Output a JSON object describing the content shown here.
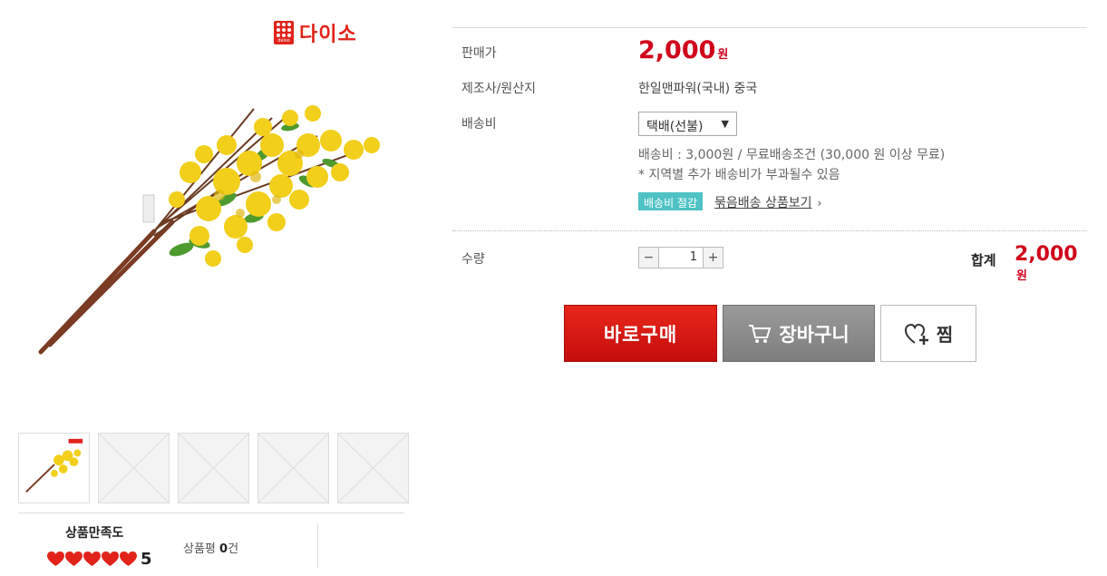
{
  "brand": {
    "name": "다이소",
    "mark_text": "daiso",
    "color": "#e2231a"
  },
  "product": {
    "image_icon": "forsythia-branch-image"
  },
  "thumbnails": [
    {
      "name": "thumb-1",
      "active": true
    },
    {
      "name": "thumb-2",
      "active": false
    },
    {
      "name": "thumb-3",
      "active": false
    },
    {
      "name": "thumb-4",
      "active": false
    },
    {
      "name": "thumb-5",
      "active": false
    }
  ],
  "rating": {
    "title": "상품만족도",
    "score": "5",
    "hearts": 5,
    "review_label": "상품평",
    "review_count": "0",
    "review_unit": "건"
  },
  "info": {
    "price_label": "판매가",
    "price_value": "2,000",
    "currency": "원",
    "maker_label": "제조사/원산지",
    "maker_value": "한일맨파워(국내) 중국",
    "shipping_label": "배송비",
    "shipping_select": "택배(선불)",
    "shipping_note1": "배송비 : 3,000원 / 무료배송조건 (30,000 원 이상 무료)",
    "shipping_note2": "* 지역별 추가 배송비가 부과될수 있음",
    "badge": "배송비 절감",
    "group_link": "묶음배송 상품보기",
    "qty_label": "수량",
    "qty_value": "1",
    "minus": "−",
    "plus": "+",
    "total_label": "합계",
    "total_value": "2,000"
  },
  "actions": {
    "buy": "바로구매",
    "cart": "장바구니",
    "wish": "찜"
  },
  "colors": {
    "accent": "#d0021b",
    "badge": "#4ec2c4"
  }
}
